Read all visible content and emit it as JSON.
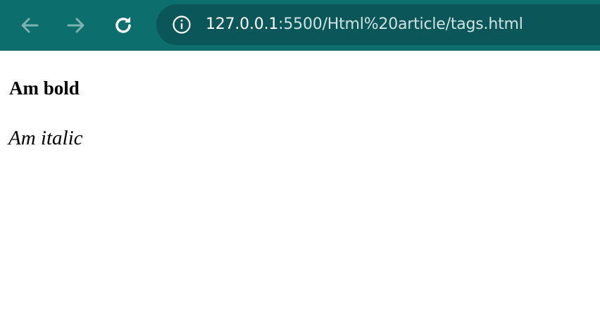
{
  "browser": {
    "address_bar": {
      "host": "127.0.0.1",
      "rest": ":5500/Html%20article/tags.html"
    },
    "icons": {
      "back": "arrow-left-icon",
      "forward": "arrow-right-icon",
      "reload": "reload-icon",
      "site_info": "info-icon"
    },
    "colors": {
      "toolbar": "#0d6e6e",
      "omnibox": "#0a5658"
    }
  },
  "page": {
    "bold_text": "Am bold",
    "italic_text": "Am italic"
  }
}
